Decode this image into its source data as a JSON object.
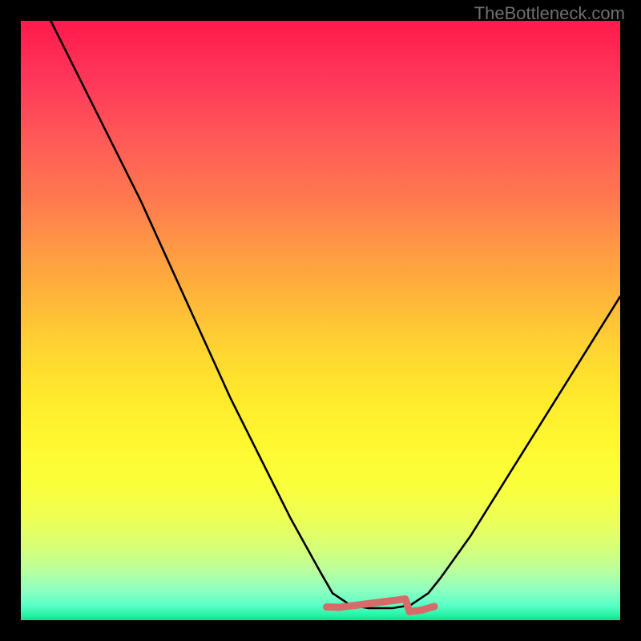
{
  "watermark": "TheBottleneck.com",
  "colors": {
    "frame": "#000000",
    "curve_stroke": "#000000",
    "bump_stroke": "#d86a6a",
    "gradient_top": "#ff1a4d",
    "gradient_bottom": "#0ee08e"
  },
  "chart_data": {
    "type": "line",
    "title": "",
    "xlabel": "",
    "ylabel": "",
    "xlim": [
      0,
      100
    ],
    "ylim": [
      0,
      100
    ],
    "grid": false,
    "legend": false,
    "annotations": [],
    "series": [
      {
        "name": "bottleneck-curve",
        "x": [
          5,
          10,
          15,
          20,
          25,
          30,
          35,
          40,
          45,
          50,
          52,
          55,
          58,
          62,
          65,
          68,
          70,
          75,
          80,
          85,
          90,
          95,
          100
        ],
        "y": [
          100,
          90,
          80,
          70,
          59,
          48,
          37,
          27,
          17,
          8,
          4.5,
          2.5,
          2,
          2,
          2.5,
          4.5,
          7,
          14,
          22,
          30,
          38,
          46,
          54
        ]
      }
    ],
    "highlight": {
      "name": "valley-bump",
      "x_range": [
        51,
        69
      ],
      "y_approx": 2.5
    }
  }
}
